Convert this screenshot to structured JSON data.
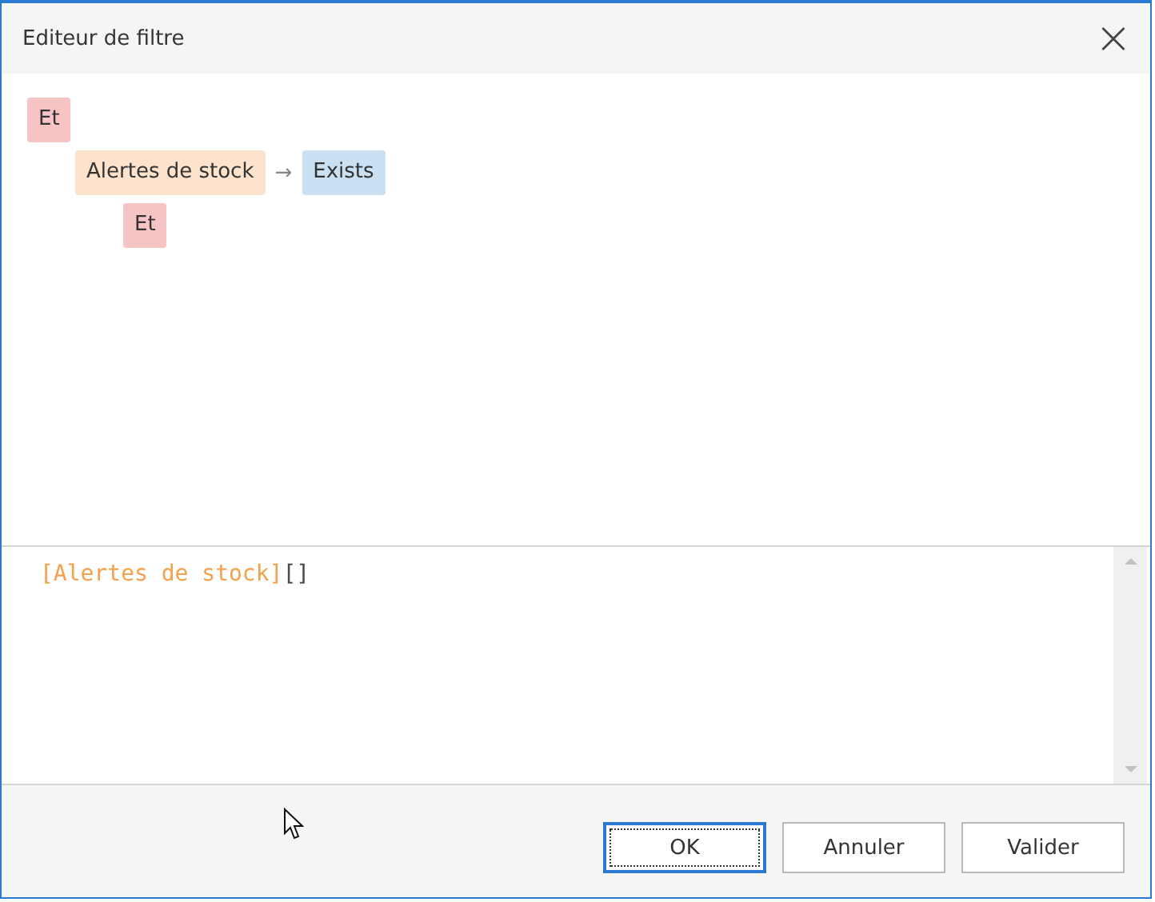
{
  "window": {
    "title": "Editeur de filtre",
    "close": "×"
  },
  "tree": [
    {
      "kind": "group",
      "label": "Et",
      "children": [
        {
          "kind": "condition",
          "field": "Alertes de stock",
          "arrow": "→",
          "operation": "Exists",
          "children": [
            {
              "kind": "group",
              "label": "Et"
            }
          ]
        }
      ]
    }
  ],
  "expression": [
    {
      "text": "[Alertes de stock]",
      "color": "#f5a04a"
    },
    {
      "text": "[]",
      "color": "#4a4a55"
    }
  ],
  "buttons": [
    {
      "label": "OK",
      "default": true
    },
    {
      "label": "Annuler",
      "default": false
    },
    {
      "label": "Valider",
      "default": false
    }
  ]
}
